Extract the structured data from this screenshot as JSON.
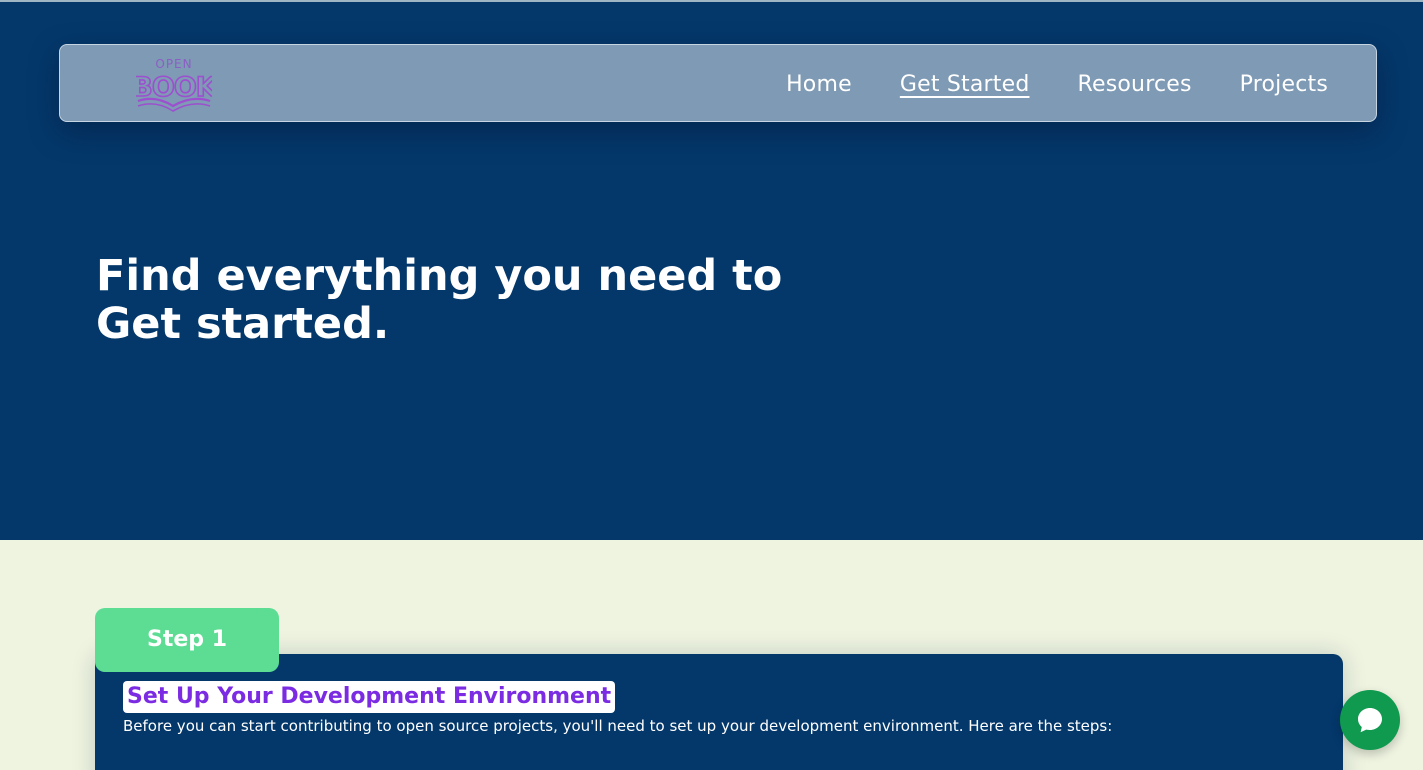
{
  "nav": {
    "logo_text_top": "OPEN",
    "logo_text_main": "BOOK",
    "links": [
      {
        "label": "Home",
        "active": false
      },
      {
        "label": "Get Started",
        "active": true
      },
      {
        "label": "Resources",
        "active": false
      },
      {
        "label": "Projects",
        "active": false
      }
    ]
  },
  "hero": {
    "title_line1": "Find everything you need to",
    "title_line2": "Get started."
  },
  "step": {
    "tab_label": "Step 1",
    "title": "Set Up Your Development Environment",
    "description": "Before you can start contributing to open source projects, you'll need to set up your development environment. Here are the steps:"
  },
  "chat": {
    "icon": "chat-bubble-icon"
  },
  "colors": {
    "hero_bg": "#04386b",
    "navbar_bg": "#7e9ab4",
    "page_bg": "#eef4e0",
    "step_tab": "#5ddc94",
    "title_accent": "#7b2be2",
    "chat_button": "#0f9a4f"
  }
}
